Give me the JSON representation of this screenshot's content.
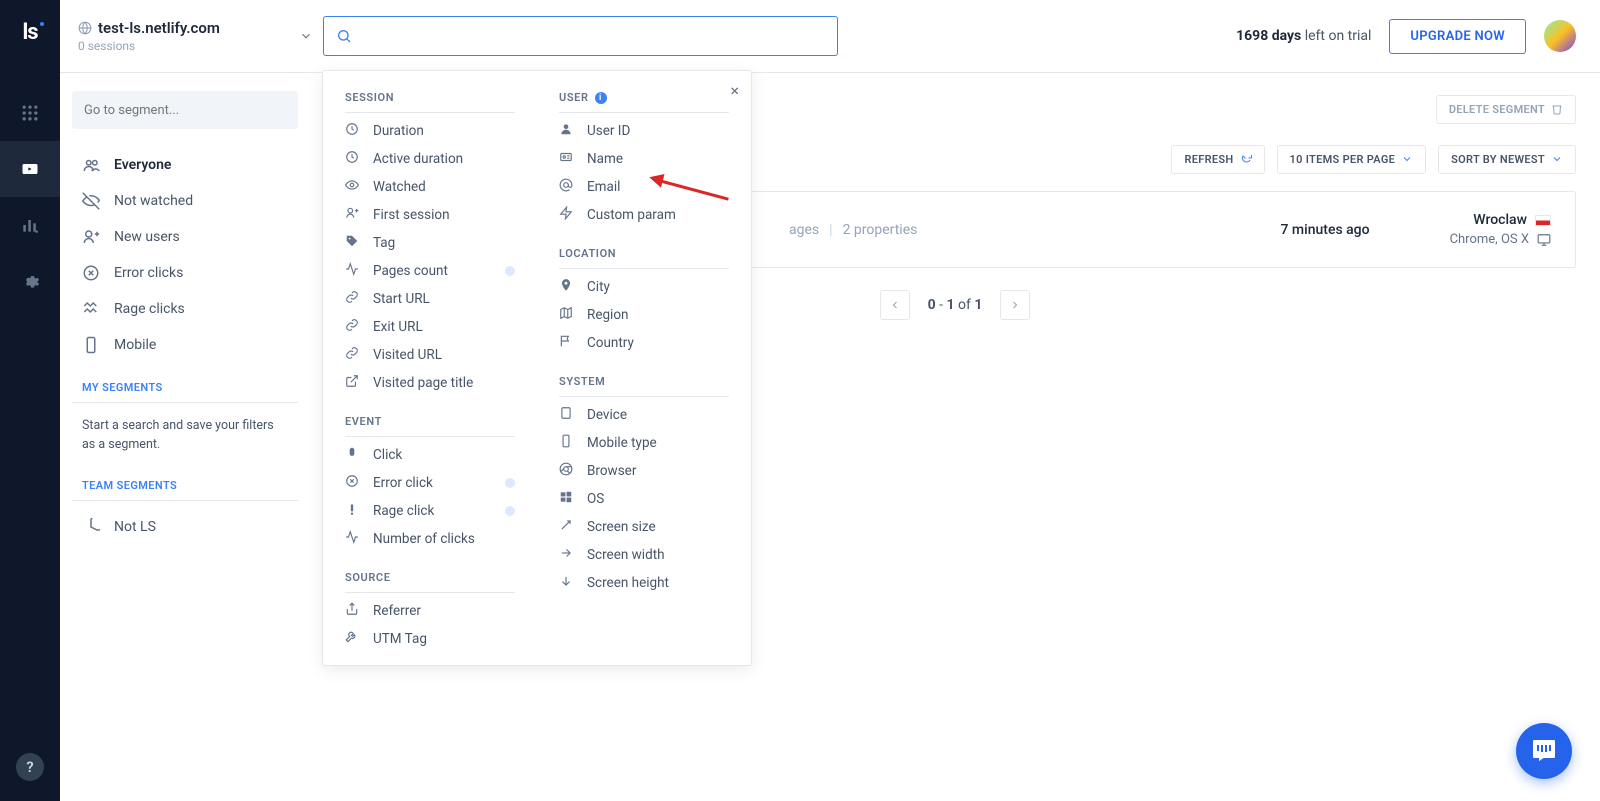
{
  "brand": "ls",
  "site": {
    "title": "test-ls.netlify.com",
    "subtitle": "0 sessions"
  },
  "trial": {
    "days": "1698 days",
    "suffix": "left on trial"
  },
  "upgrade_label": "UPGRADE NOW",
  "segment_search_placeholder": "Go to segment...",
  "segments": [
    {
      "label": "Everyone",
      "icon": "users",
      "bold": true
    },
    {
      "label": "Not watched",
      "icon": "eye-off"
    },
    {
      "label": "New users",
      "icon": "user-plus"
    },
    {
      "label": "Error clicks",
      "icon": "x-circle"
    },
    {
      "label": "Rage clicks",
      "icon": "rage"
    },
    {
      "label": "Mobile",
      "icon": "mobile"
    }
  ],
  "my_segments_label": "MY SEGMENTS",
  "my_segments_hint": "Start a search and save your filters as a segment.",
  "team_segments_label": "TEAM SEGMENTS",
  "team_segments": [
    {
      "label": "Not LS",
      "icon": "pie"
    }
  ],
  "toolbar": {
    "delete": "DELETE SEGMENT",
    "refresh": "REFRESH",
    "items_per_page": "10 ITEMS PER PAGE",
    "sort": "SORT BY NEWEST"
  },
  "session": {
    "pages_label": "ages",
    "properties": "2 properties",
    "time": "7 minutes ago",
    "city": "Wroclaw",
    "system": "Chrome, OS X"
  },
  "pagination": "0 - 1 of 1",
  "dropdown": {
    "col1": {
      "session_head": "SESSION",
      "session_items": [
        {
          "label": "Duration",
          "icon": "clock"
        },
        {
          "label": "Active duration",
          "icon": "clock"
        },
        {
          "label": "Watched",
          "icon": "eye"
        },
        {
          "label": "First session",
          "icon": "user-plus"
        },
        {
          "label": "Tag",
          "icon": "tag"
        },
        {
          "label": "Pages count",
          "icon": "activity",
          "dot": true
        },
        {
          "label": "Start URL",
          "icon": "link"
        },
        {
          "label": "Exit URL",
          "icon": "link"
        },
        {
          "label": "Visited URL",
          "icon": "link"
        },
        {
          "label": "Visited page title",
          "icon": "external"
        }
      ],
      "event_head": "EVENT",
      "event_items": [
        {
          "label": "Click",
          "icon": "mouse"
        },
        {
          "label": "Error click",
          "icon": "x-circle",
          "dot": true
        },
        {
          "label": "Rage click",
          "icon": "alert",
          "dot": true
        },
        {
          "label": "Number of clicks",
          "icon": "activity"
        }
      ],
      "source_head": "SOURCE",
      "source_items": [
        {
          "label": "Referrer",
          "icon": "share"
        },
        {
          "label": "UTM Tag",
          "icon": "wrench"
        }
      ]
    },
    "col2": {
      "user_head": "USER",
      "user_items": [
        {
          "label": "User ID",
          "icon": "user"
        },
        {
          "label": "Name",
          "icon": "id"
        },
        {
          "label": "Email",
          "icon": "at"
        },
        {
          "label": "Custom param",
          "icon": "bolt"
        }
      ],
      "location_head": "LOCATION",
      "location_items": [
        {
          "label": "City",
          "icon": "pin"
        },
        {
          "label": "Region",
          "icon": "map"
        },
        {
          "label": "Country",
          "icon": "flag"
        }
      ],
      "system_head": "SYSTEM",
      "system_items": [
        {
          "label": "Device",
          "icon": "tablet"
        },
        {
          "label": "Mobile type",
          "icon": "mobile"
        },
        {
          "label": "Browser",
          "icon": "chrome"
        },
        {
          "label": "OS",
          "icon": "windows"
        },
        {
          "label": "Screen size",
          "icon": "expand"
        },
        {
          "label": "Screen width",
          "icon": "arrow-right"
        },
        {
          "label": "Screen height",
          "icon": "arrow-down"
        }
      ]
    }
  }
}
